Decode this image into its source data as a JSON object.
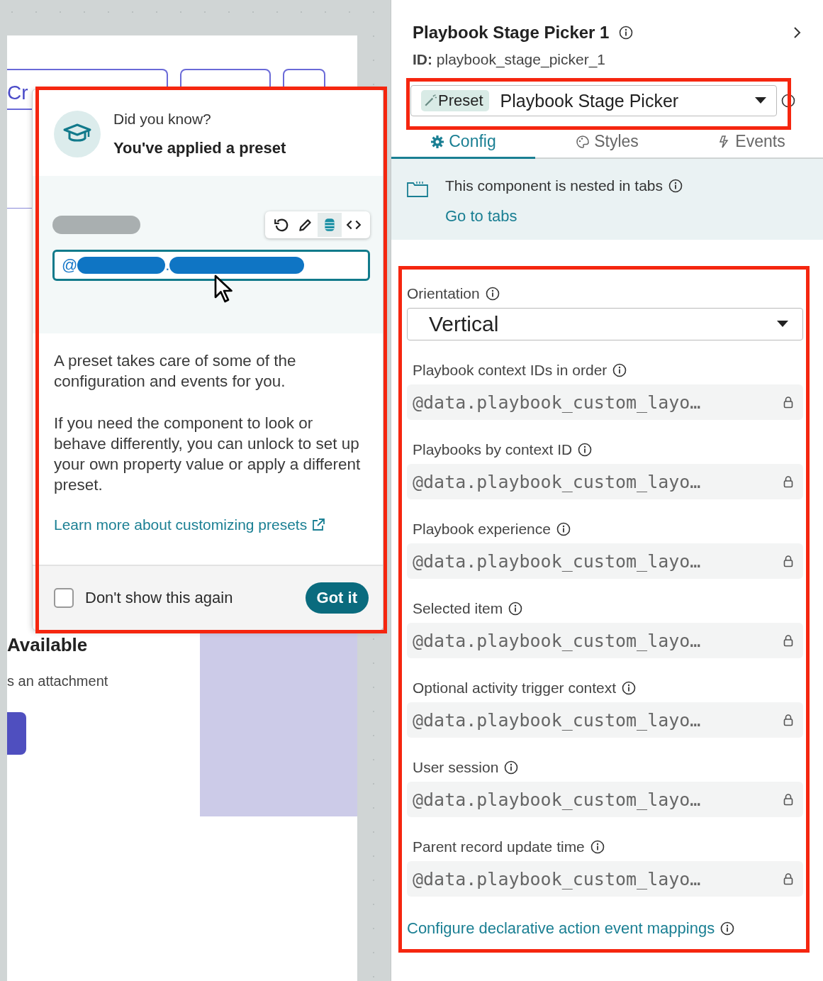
{
  "canvas": {
    "button_label": "Cr",
    "heading": "Available",
    "subtext": "s an attachment"
  },
  "popover": {
    "eyebrow": "Did you know?",
    "title": "You've applied a preset",
    "toolbar": [
      {
        "kind": "reset",
        "selected": false
      },
      {
        "kind": "pencil",
        "selected": false
      },
      {
        "kind": "database",
        "selected": true
      },
      {
        "kind": "code",
        "selected": false
      }
    ],
    "field_prefix": "@",
    "field_separator": ".",
    "paragraphs": [
      "A preset takes care of some of the configuration and events for you.",
      "If you need the component to look or behave differently, you can unlock to set up your own property value or apply a different preset."
    ],
    "link": "Learn more about customizing presets",
    "checkbox": {
      "label": "Don't show this again",
      "checked": false
    },
    "button": "Got it"
  },
  "panel": {
    "title": "Playbook Stage Picker 1",
    "id_label": "ID:",
    "id_value": "playbook_stage_picker_1",
    "preset": {
      "badge": "Preset",
      "value": "Playbook Stage Picker"
    },
    "tabs": [
      {
        "kind": "config",
        "label": "Config",
        "selected": true
      },
      {
        "kind": "styles",
        "label": "Styles",
        "selected": false
      },
      {
        "kind": "events",
        "label": "Events",
        "selected": false
      }
    ],
    "banner": {
      "text": "This component is nested in tabs",
      "link": "Go to tabs"
    },
    "orientation": {
      "label": "Orientation",
      "value": "Vertical"
    },
    "fields": [
      {
        "label": "Playbook context IDs in order",
        "value": "@data.playbook_custom_layo…"
      },
      {
        "label": "Playbooks by context ID",
        "value": "@data.playbook_custom_layo…"
      },
      {
        "label": "Playbook experience",
        "value": "@data.playbook_custom_layo…"
      },
      {
        "label": "Selected item",
        "value": "@data.playbook_custom_layo…"
      },
      {
        "label": "Optional activity trigger context",
        "value": "@data.playbook_custom_layo…"
      },
      {
        "label": "User session",
        "value": "@data.playbook_custom_layo…"
      },
      {
        "label": "Parent record update time",
        "value": "@data.playbook_custom_layo…"
      }
    ],
    "footer_link": "Configure declarative action event mappings"
  }
}
